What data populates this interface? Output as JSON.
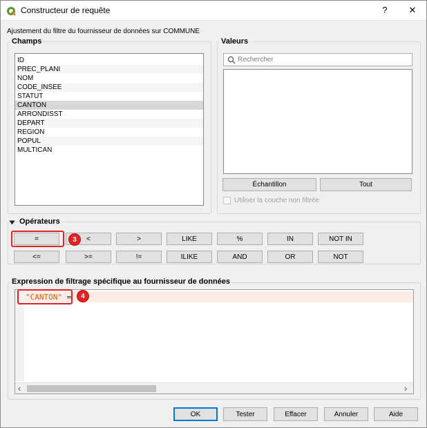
{
  "window": {
    "title": "Constructeur de requête",
    "help_glyph": "?",
    "close_glyph": "✕"
  },
  "subtitle": "Ajustement du filtre du fournisseur de données sur COMMUNE",
  "fields": {
    "title": "Champs",
    "items": [
      "ID",
      "PREC_PLANI",
      "NOM",
      "CODE_INSEE",
      "STATUT",
      "CANTON",
      "ARRONDISST",
      "DEPART",
      "REGION",
      "POPUL",
      "MULTICAN"
    ],
    "selected": "CANTON"
  },
  "values": {
    "title": "Valeurs",
    "search_placeholder": "Rechercher",
    "sample_button": "Échantillon",
    "all_button": "Tout",
    "unfiltered_checkbox": "Utiliser la couche non filtrée"
  },
  "operators": {
    "title": "Opérateurs",
    "row1": [
      "=",
      "<",
      ">",
      "LIKE",
      "%",
      "IN",
      "NOT IN"
    ],
    "row2": [
      "<=",
      ">=",
      "!=",
      "ILIKE",
      "AND",
      "OR",
      "NOT"
    ]
  },
  "expression": {
    "title": "Expression de filtrage spécifique au fournisseur de données",
    "field_token": "\"CANTON\"",
    "operator_token": " ="
  },
  "annotations": {
    "badge3": "3",
    "badge4": "4",
    "accent": "#e02424"
  },
  "footer": {
    "ok": "OK",
    "test": "Tester",
    "clear": "Effacer",
    "cancel": "Annuler",
    "help": "Aide"
  },
  "scroll": {
    "left_arrow": "‹",
    "right_arrow": "›"
  }
}
